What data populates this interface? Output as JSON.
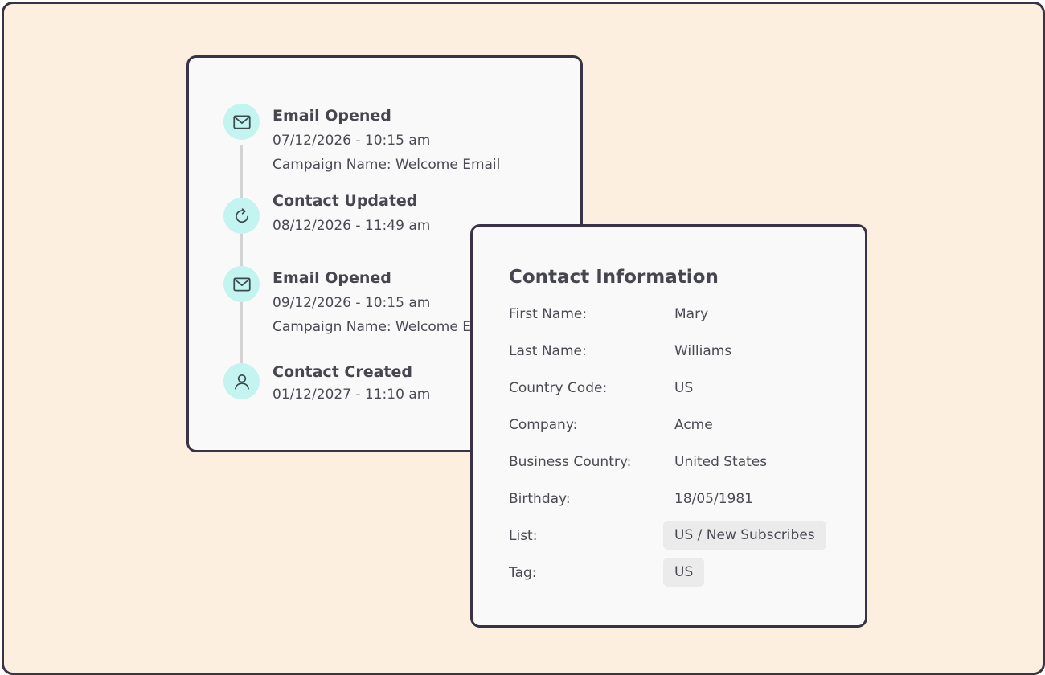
{
  "timeline": {
    "events": [
      {
        "title": "Email Opened",
        "date": "07/12/2026 - 10:15 am",
        "detail": "Campaign Name: Welcome Email",
        "icon": "mail-icon"
      },
      {
        "title": "Contact Updated",
        "date": "08/12/2026 - 11:49 am",
        "icon": "refresh-icon"
      },
      {
        "title": "Email Opened",
        "date": "09/12/2026 - 10:15 am",
        "detail": "Campaign Name: Welcome Email",
        "icon": "mail-icon"
      },
      {
        "title": "Contact Created",
        "date": "01/12/2027 - 11:10 am",
        "icon": "user-icon"
      }
    ]
  },
  "contact": {
    "title": "Contact Information",
    "rows": [
      {
        "label": "First Name:",
        "value": "Mary"
      },
      {
        "label": "Last Name:",
        "value": "Williams"
      },
      {
        "label": "Country Code:",
        "value": "US"
      },
      {
        "label": "Company:",
        "value": "Acme"
      },
      {
        "label": "Business Country:",
        "value": "United States"
      },
      {
        "label": "Birthday:",
        "value": "18/05/1981"
      },
      {
        "label": "List:",
        "value": "US / New Subscribes"
      },
      {
        "label": "Tag:",
        "value": "US"
      }
    ]
  },
  "colors": {
    "background": "#fdefdf",
    "card": "#f9f9f9",
    "border": "#3a3247",
    "icon_bg": "#c4f4ef",
    "pill": "#ebebeb"
  }
}
